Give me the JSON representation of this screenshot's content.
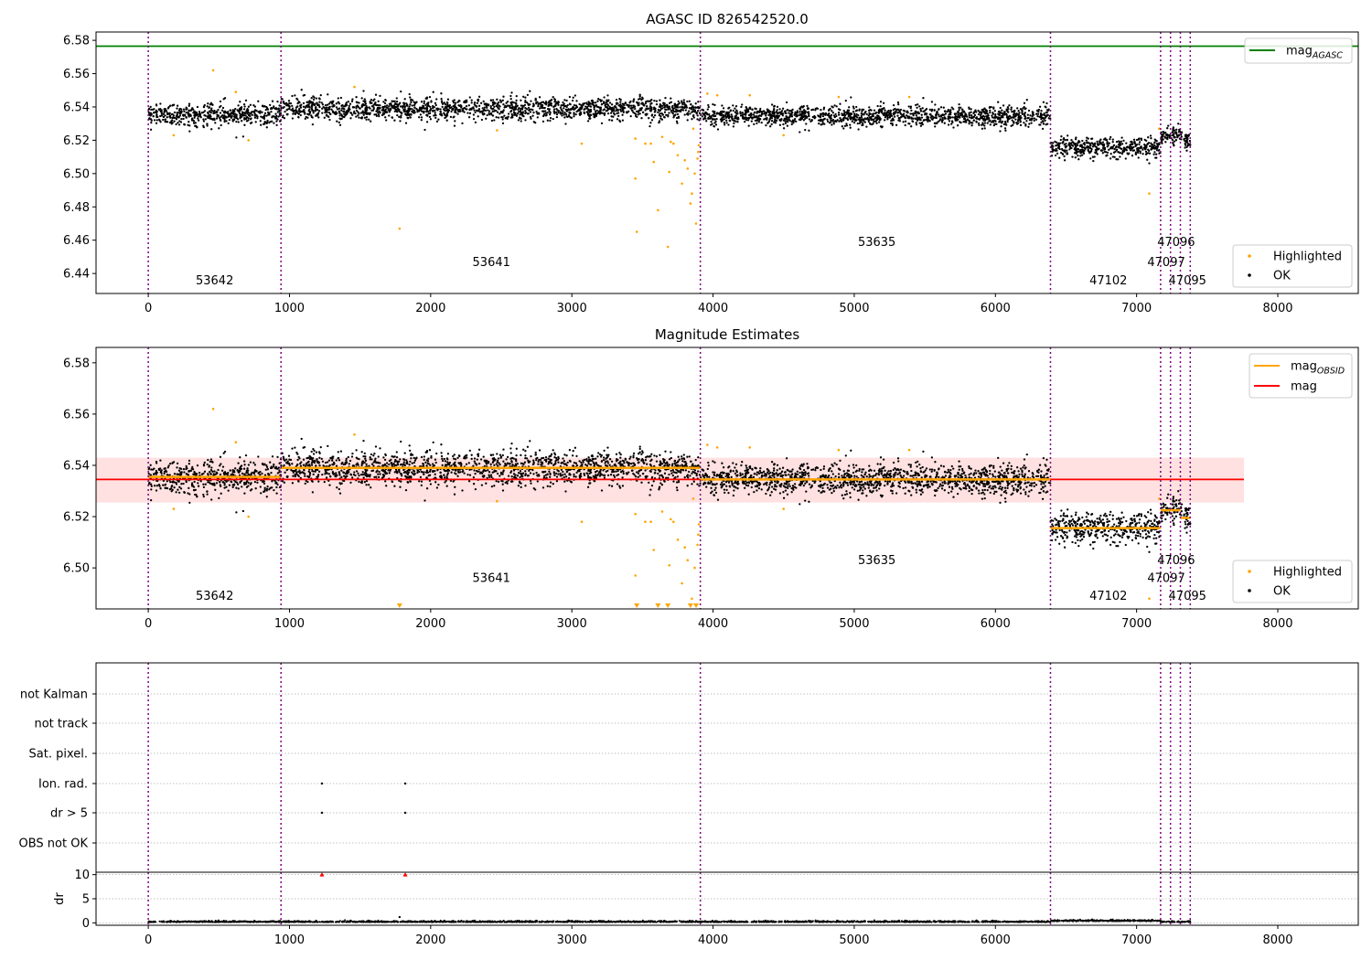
{
  "chart_data": [
    {
      "type": "scatter",
      "panel": "agasc",
      "title": "AGASC ID 826542520.0",
      "xlim": [
        -370,
        8570
      ],
      "ylim": [
        6.428,
        6.585
      ],
      "xticks": [
        0,
        1000,
        2000,
        3000,
        4000,
        5000,
        6000,
        7000,
        8000
      ],
      "xtick_labels": [
        "0",
        "1000",
        "2000",
        "3000",
        "4000",
        "5000",
        "6000",
        "7000",
        "8000"
      ],
      "yticks": [
        6.44,
        6.46,
        6.48,
        6.5,
        6.52,
        6.54,
        6.56,
        6.58
      ],
      "ytick_labels": [
        "6.44",
        "6.46",
        "6.48",
        "6.50",
        "6.52",
        "6.54",
        "6.56",
        "6.58"
      ],
      "hlines": [
        {
          "label_main": "mag",
          "label_sub": "AGASC",
          "y": 6.5765,
          "color": "#008000"
        }
      ],
      "legend_top": [
        {
          "label_main": "mag",
          "label_sub": "AGASC",
          "color": "#008000",
          "kind": "line"
        }
      ],
      "legend_bottom": [
        {
          "label": "Highlighted",
          "color": "#ffa500",
          "kind": "dot"
        },
        {
          "label": "OK",
          "color": "#000000",
          "kind": "dot"
        }
      ],
      "obsid_labels": [
        {
          "text": "53642",
          "x": 470,
          "y": 6.4335
        },
        {
          "text": "53641",
          "x": 2430,
          "y": 6.4445
        },
        {
          "text": "53635",
          "x": 5160,
          "y": 6.4565
        },
        {
          "text": "47102",
          "x": 6800,
          "y": 6.4335
        },
        {
          "text": "47097",
          "x": 7210,
          "y": 6.4445
        },
        {
          "text": "47096",
          "x": 7280,
          "y": 6.4565
        },
        {
          "text": "47095",
          "x": 7360,
          "y": 6.4335
        }
      ]
    },
    {
      "type": "scatter",
      "panel": "estimates",
      "title": "Magnitude Estimates",
      "xlim": [
        -370,
        8570
      ],
      "ylim": [
        6.484,
        6.586
      ],
      "xticks": [
        0,
        1000,
        2000,
        3000,
        4000,
        5000,
        6000,
        7000,
        8000
      ],
      "xtick_labels": [
        "0",
        "1000",
        "2000",
        "3000",
        "4000",
        "5000",
        "6000",
        "7000",
        "8000"
      ],
      "yticks": [
        6.5,
        6.52,
        6.54,
        6.56,
        6.58
      ],
      "ytick_labels": [
        "6.50",
        "6.52",
        "6.54",
        "6.56",
        "6.58"
      ],
      "mag_line": {
        "y": 6.5345,
        "band": [
          6.5255,
          6.543
        ],
        "x_range": [
          -370,
          7760
        ],
        "color": "#ff0000"
      },
      "mag_obsid_segments": [
        {
          "x0": 0,
          "x1": 940,
          "y": 6.5355
        },
        {
          "x0": 940,
          "x1": 3910,
          "y": 6.539
        },
        {
          "x0": 3910,
          "x1": 6390,
          "y": 6.5345
        },
        {
          "x0": 6390,
          "x1": 7170,
          "y": 6.5155
        },
        {
          "x0": 7170,
          "x1": 7240,
          "y": 6.5225
        },
        {
          "x0": 7240,
          "x1": 7310,
          "y": 6.5225
        },
        {
          "x0": 7310,
          "x1": 7380,
          "y": 6.5195
        }
      ],
      "legend_top": [
        {
          "label_main": "mag",
          "label_sub": "OBSID",
          "color": "#ffa500",
          "kind": "line"
        },
        {
          "label_main": "mag",
          "label_sub": "",
          "color": "#ff0000",
          "kind": "line"
        }
      ],
      "legend_bottom": [
        {
          "label": "Highlighted",
          "color": "#ffa500",
          "kind": "dot"
        },
        {
          "label": "OK",
          "color": "#000000",
          "kind": "dot"
        }
      ],
      "obsid_labels": [
        {
          "text": "53642",
          "x": 470,
          "y": 6.4875
        },
        {
          "text": "53641",
          "x": 2430,
          "y": 6.4945
        },
        {
          "text": "53635",
          "x": 5160,
          "y": 6.5015
        },
        {
          "text": "47102",
          "x": 6800,
          "y": 6.4875
        },
        {
          "text": "47097",
          "x": 7210,
          "y": 6.4945
        },
        {
          "text": "47096",
          "x": 7280,
          "y": 6.5015
        },
        {
          "text": "47095",
          "x": 7360,
          "y": 6.4875
        }
      ]
    },
    {
      "type": "scatter",
      "panel": "flags",
      "xlim": [
        -370,
        8570
      ],
      "categories": [
        "not Kalman",
        "not track",
        "Sat. pixel.",
        "Ion. rad.",
        "dr > 5",
        "OBS not OK"
      ],
      "flag_points": [
        {
          "category": "Ion. rad.",
          "x": 1230
        },
        {
          "category": "Ion. rad.",
          "x": 1820
        },
        {
          "category": "dr > 5",
          "x": 1230
        },
        {
          "category": "dr > 5",
          "x": 1820
        }
      ]
    },
    {
      "type": "scatter",
      "panel": "dr",
      "ylabel": "dr",
      "xlim": [
        -370,
        8570
      ],
      "ylim": [
        -0.5,
        10.5
      ],
      "xticks": [
        0,
        1000,
        2000,
        3000,
        4000,
        5000,
        6000,
        7000,
        8000
      ],
      "xtick_labels": [
        "0",
        "1000",
        "2000",
        "3000",
        "4000",
        "5000",
        "6000",
        "7000",
        "8000"
      ],
      "yticks": [
        0,
        5,
        10
      ],
      "ytick_labels": [
        "0",
        "5",
        "10"
      ],
      "clipped_markers": [
        {
          "x": 1230,
          "y": 10
        },
        {
          "x": 1820,
          "y": 10
        }
      ],
      "outliers": [
        {
          "x": 1780,
          "y": 1.2
        }
      ]
    }
  ],
  "obsid_boundaries": [
    0,
    940,
    3910,
    6390,
    7170,
    7240,
    7310,
    7380
  ],
  "colors": {
    "ok": "#000000",
    "highlight": "#ffa500",
    "boundary": "#800080",
    "agasc": "#008000",
    "mag": "#ff0000",
    "band": "#ffc8c8",
    "grid": "#b0b0b0"
  }
}
